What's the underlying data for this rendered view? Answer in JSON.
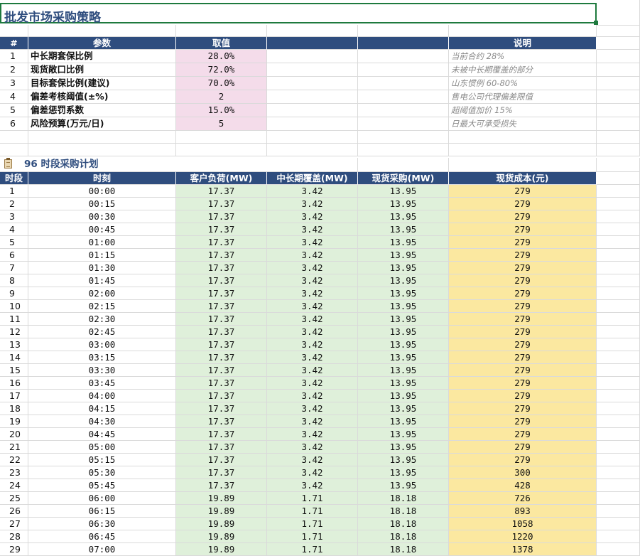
{
  "sheet": {
    "title": "批发市场采购策略"
  },
  "params": {
    "headers": [
      "#",
      "参数",
      "取值",
      "",
      "",
      "说明"
    ],
    "rows": [
      {
        "n": "1",
        "name": "中长期套保比例",
        "value": "28.0%",
        "note": "当前合约 28%"
      },
      {
        "n": "2",
        "name": "现货敞口比例",
        "value": "72.0%",
        "note": "未被中长期覆盖的部分"
      },
      {
        "n": "3",
        "name": "目标套保比例(建议)",
        "value": "70.0%",
        "note": "山东惯例 60-80%"
      },
      {
        "n": "4",
        "name": "偏差考核阈值(±%)",
        "value": "2",
        "note": "售电公司代理偏差限值"
      },
      {
        "n": "5",
        "name": "偏差惩罚系数",
        "value": "15.0%",
        "note": "超阈值加价 15%"
      },
      {
        "n": "6",
        "name": "风险预算(万元/日)",
        "value": "5",
        "note": "日最大可承受损失"
      }
    ]
  },
  "plan": {
    "section_title": "96 时段采购计划",
    "headers": [
      "时段",
      "时刻",
      "客户负荷(MW)",
      "中长期覆盖(MW)",
      "现货采购(MW)",
      "现货成本(元)"
    ],
    "rows": [
      [
        "1",
        "00:00",
        "17.37",
        "3.42",
        "13.95",
        "279"
      ],
      [
        "2",
        "00:15",
        "17.37",
        "3.42",
        "13.95",
        "279"
      ],
      [
        "3",
        "00:30",
        "17.37",
        "3.42",
        "13.95",
        "279"
      ],
      [
        "4",
        "00:45",
        "17.37",
        "3.42",
        "13.95",
        "279"
      ],
      [
        "5",
        "01:00",
        "17.37",
        "3.42",
        "13.95",
        "279"
      ],
      [
        "6",
        "01:15",
        "17.37",
        "3.42",
        "13.95",
        "279"
      ],
      [
        "7",
        "01:30",
        "17.37",
        "3.42",
        "13.95",
        "279"
      ],
      [
        "8",
        "01:45",
        "17.37",
        "3.42",
        "13.95",
        "279"
      ],
      [
        "9",
        "02:00",
        "17.37",
        "3.42",
        "13.95",
        "279"
      ],
      [
        "10",
        "02:15",
        "17.37",
        "3.42",
        "13.95",
        "279"
      ],
      [
        "11",
        "02:30",
        "17.37",
        "3.42",
        "13.95",
        "279"
      ],
      [
        "12",
        "02:45",
        "17.37",
        "3.42",
        "13.95",
        "279"
      ],
      [
        "13",
        "03:00",
        "17.37",
        "3.42",
        "13.95",
        "279"
      ],
      [
        "14",
        "03:15",
        "17.37",
        "3.42",
        "13.95",
        "279"
      ],
      [
        "15",
        "03:30",
        "17.37",
        "3.42",
        "13.95",
        "279"
      ],
      [
        "16",
        "03:45",
        "17.37",
        "3.42",
        "13.95",
        "279"
      ],
      [
        "17",
        "04:00",
        "17.37",
        "3.42",
        "13.95",
        "279"
      ],
      [
        "18",
        "04:15",
        "17.37",
        "3.42",
        "13.95",
        "279"
      ],
      [
        "19",
        "04:30",
        "17.37",
        "3.42",
        "13.95",
        "279"
      ],
      [
        "20",
        "04:45",
        "17.37",
        "3.42",
        "13.95",
        "279"
      ],
      [
        "21",
        "05:00",
        "17.37",
        "3.42",
        "13.95",
        "279"
      ],
      [
        "22",
        "05:15",
        "17.37",
        "3.42",
        "13.95",
        "279"
      ],
      [
        "23",
        "05:30",
        "17.37",
        "3.42",
        "13.95",
        "300"
      ],
      [
        "24",
        "05:45",
        "17.37",
        "3.42",
        "13.95",
        "428"
      ],
      [
        "25",
        "06:00",
        "19.89",
        "1.71",
        "18.18",
        "726"
      ],
      [
        "26",
        "06:15",
        "19.89",
        "1.71",
        "18.18",
        "893"
      ],
      [
        "27",
        "06:30",
        "19.89",
        "1.71",
        "18.18",
        "1058"
      ],
      [
        "28",
        "06:45",
        "19.89",
        "1.71",
        "18.18",
        "1220"
      ],
      [
        "29",
        "07:00",
        "19.89",
        "1.71",
        "18.18",
        "1378"
      ]
    ]
  },
  "colors": {
    "header_bg": "#2f4d7e",
    "param_value_bg": "#f4dcea",
    "load_bg": "#dff0da",
    "cost_bg": "#fbe8a0",
    "selection_border": "#1e7a3e"
  }
}
